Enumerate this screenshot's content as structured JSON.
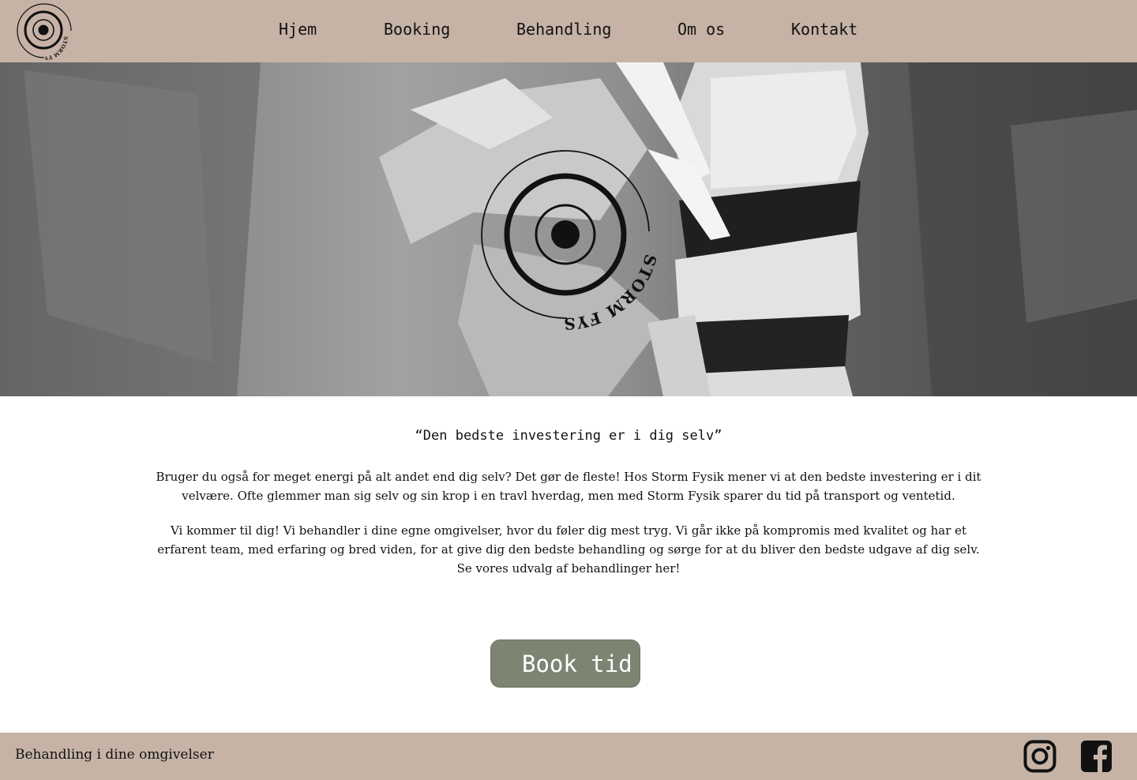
{
  "brand": {
    "logo_text": "STORM FYSIK",
    "logo_icon": "target-rings-icon"
  },
  "nav": {
    "items": [
      {
        "label": "Hjem"
      },
      {
        "label": "Booking"
      },
      {
        "label": "Behandling"
      },
      {
        "label": "Om os"
      },
      {
        "label": "Kontakt"
      }
    ]
  },
  "hero": {
    "image": "spine-model-photo",
    "tone": "grayscale"
  },
  "intro": {
    "quote": "“Den bedste investering er i dig selv”",
    "paragraph1": "Bruger du også for meget energi på alt andet end dig selv? Det gør de fleste! Hos Storm Fysik mener vi at den bedste investering er i dit velvære. Ofte glemmer man sig selv og sin krop i en travl hverdag, men med Storm Fysik sparer du tid på transport og ventetid.",
    "paragraph2": "Vi kommer til dig! Vi behandler i dine egne omgivelser, hvor du føler dig mest tryg. Vi går ikke på kompromis med kvalitet og har et erfarent team, med erfaring og bred viden, for at give dig den bedste behandling og sørge for at du bliver den bedste udgave af dig selv. Se vores udvalg af behandlinger her!"
  },
  "cta": {
    "label": "Book tid"
  },
  "footer": {
    "tagline": "Behandling i dine omgivelser",
    "social": [
      "instagram-icon",
      "facebook-icon"
    ]
  },
  "colors": {
    "header_bg": "#c6b3a6",
    "footer_bg": "#c6b3a6",
    "button_bg": "#7d8472",
    "button_text": "#ffffff"
  }
}
